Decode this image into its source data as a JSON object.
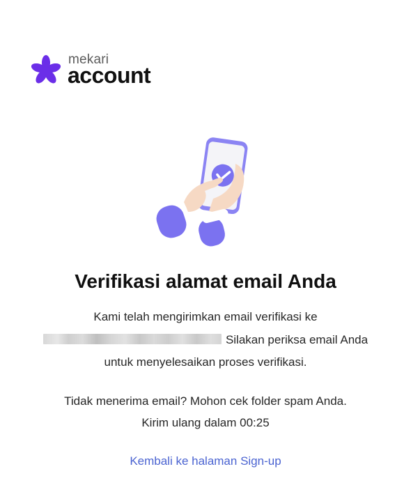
{
  "brand": {
    "company": "mekari",
    "product": "account",
    "logo_icon": "mekari-star-icon",
    "accent_color": "#6b2ee8"
  },
  "illustration": {
    "icon": "phone-verified-hand-icon",
    "primary_color": "#7b72f0"
  },
  "page": {
    "title": "Verifikasi alamat email Anda",
    "message_line1": "Kami telah mengirimkan email verifikasi ke",
    "message_line2_suffix": "Silakan periksa email Anda",
    "message_line3": "untuk menyelesaikan proses verifikasi.",
    "spam_hint": "Tidak menerima email? Mohon cek folder spam Anda.",
    "resend_countdown": "Kirim ulang dalam 00:25"
  },
  "actions": {
    "back_to_signup": "Kembali ke halaman Sign-up",
    "link_color": "#4a63d1"
  }
}
